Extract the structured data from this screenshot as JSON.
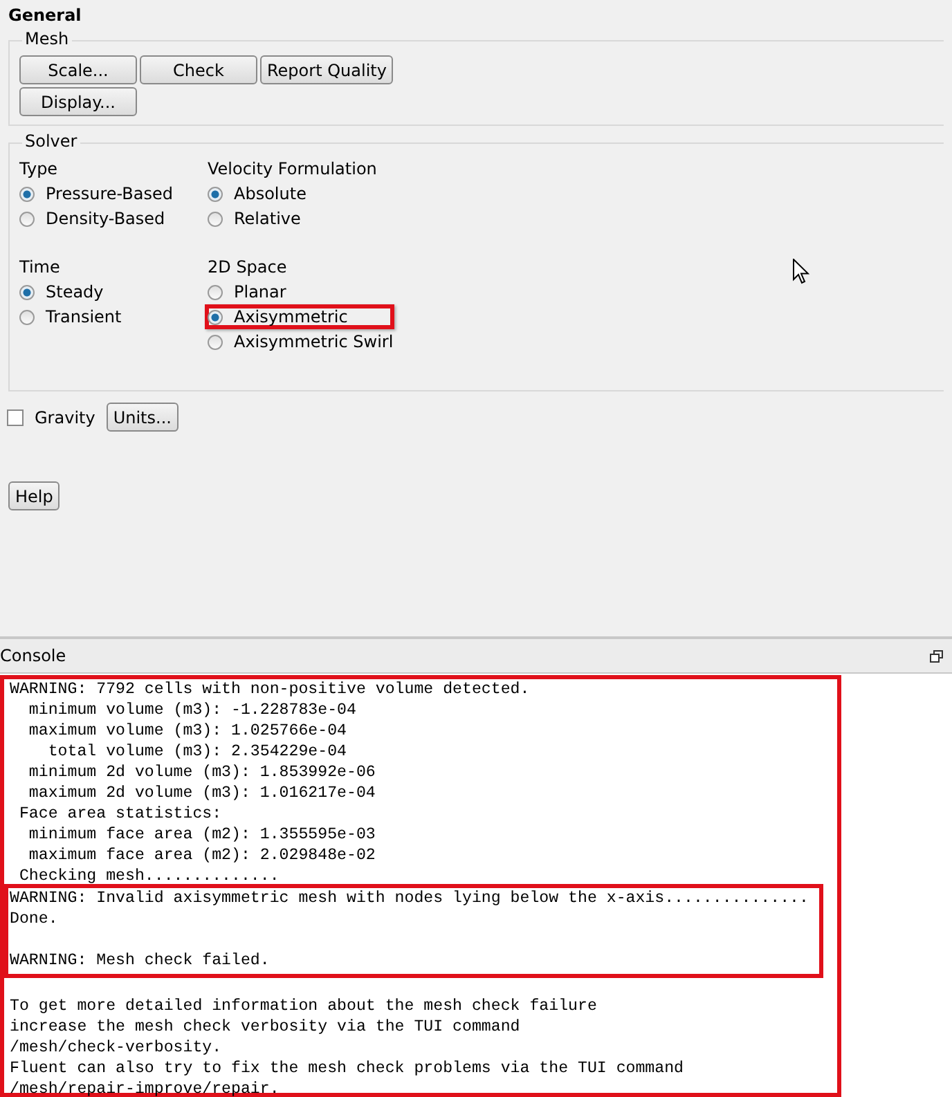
{
  "panel": {
    "title": "General"
  },
  "mesh": {
    "title": "Mesh",
    "buttons": [
      "Scale...",
      "Check",
      "Report Quality",
      "Display..."
    ]
  },
  "solver": {
    "title": "Solver",
    "groups": [
      {
        "title": "Type",
        "options": [
          {
            "label": "Pressure-Based",
            "selected": true,
            "highlighted": false
          },
          {
            "label": "Density-Based",
            "selected": false,
            "highlighted": false
          }
        ]
      },
      {
        "title": "Velocity Formulation",
        "options": [
          {
            "label": "Absolute",
            "selected": true,
            "highlighted": false
          },
          {
            "label": "Relative",
            "selected": false,
            "highlighted": false
          }
        ]
      },
      {
        "title": "Time",
        "options": [
          {
            "label": "Steady",
            "selected": true,
            "highlighted": false
          },
          {
            "label": "Transient",
            "selected": false,
            "highlighted": false
          }
        ]
      },
      {
        "title": "2D Space",
        "options": [
          {
            "label": "Planar",
            "selected": false,
            "highlighted": false
          },
          {
            "label": "Axisymmetric",
            "selected": true,
            "highlighted": true
          },
          {
            "label": "Axisymmetric Swirl",
            "selected": false,
            "highlighted": false
          }
        ]
      }
    ]
  },
  "gravity": {
    "label": "Gravity",
    "checked": false
  },
  "units_button": "Units...",
  "help_button": "Help",
  "console": {
    "title": "Console",
    "framed": true,
    "blocks": [
      {
        "framed": false,
        "paragraphs": [
          [
            "WARNING: 7792 cells with non-positive volume detected.",
            "  minimum volume (m3): -1.228783e-04",
            "  maximum volume (m3): 1.025766e-04",
            "    total volume (m3): 2.354229e-04",
            "  minimum 2d volume (m3): 1.853992e-06",
            "  maximum 2d volume (m3): 1.016217e-04",
            " Face area statistics:",
            "  minimum face area (m2): 1.355595e-03",
            "  maximum face area (m2): 2.029848e-02",
            " Checking mesh.............."
          ]
        ]
      },
      {
        "framed": true,
        "paragraphs": [
          [
            "WARNING: Invalid axisymmetric mesh with nodes lying below the x-axis...............",
            "Done."
          ],
          [
            "WARNING: Mesh check failed."
          ]
        ]
      },
      {
        "framed": false,
        "paragraphs": [
          [
            "To get more detailed information about the mesh check failure",
            "increase the mesh check verbosity via the TUI command",
            "/mesh/check-verbosity.",
            "Fluent can also try to fix the mesh check problems via the TUI command",
            "/mesh/repair-improve/repair."
          ]
        ]
      }
    ]
  }
}
